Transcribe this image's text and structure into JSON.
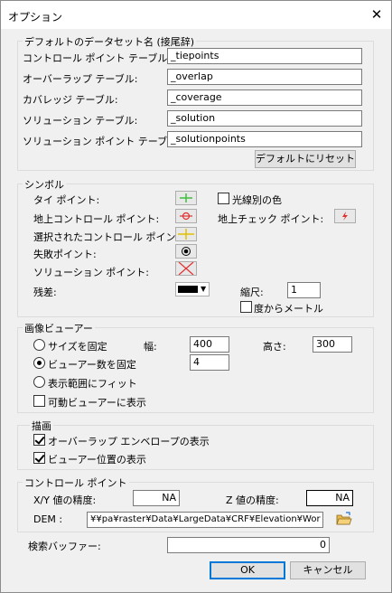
{
  "window": {
    "title": "オプション"
  },
  "dataset_names": {
    "heading": "デフォルトのデータセット名 (接尾辞)",
    "rows": [
      {
        "label": "コントロール ポイント テーブル:",
        "value": "_tiepoints"
      },
      {
        "label": "オーバーラップ テーブル:",
        "value": "_overlap"
      },
      {
        "label": "カバレッジ テーブル:",
        "value": "_coverage"
      },
      {
        "label": "ソリューション テーブル:",
        "value": "_solution"
      },
      {
        "label": "ソリューション ポイント テーブル:",
        "value": "_solutionpoints"
      }
    ],
    "reset_button": "デフォルトにリセット"
  },
  "symbols": {
    "heading": "シンボル",
    "tie_point": "タイ ポイント:",
    "gcp": "地上コントロール ポイント:",
    "selected_gcp": "選択されたコントロール ポイント:",
    "failed_point": "失敗ポイント:",
    "solution_point": "ソリューション ポイント:",
    "residual": "残差:",
    "color_by_ray": "光線別の色",
    "check_point": "地上チェック ポイント:",
    "scale_label": "縮尺:",
    "scale_value": "1",
    "degree_to_meter": "度からメートル",
    "colors": {
      "tie_point": "#3fbf3f",
      "gcp": "#e03030",
      "selected_gcp": "#e0c000",
      "failed": "#000000",
      "solution": "#e03030",
      "residual": "#000000",
      "check_point": "#e03030"
    }
  },
  "image_viewer": {
    "heading": "画像ビューアー",
    "fixed_size": "サイズを固定",
    "width_label": "幅:",
    "width_value": "400",
    "height_label": "高さ:",
    "height_value": "300",
    "fixed_count": "ビューアー数を固定",
    "count_value": "4",
    "fit_extent": "表示範囲にフィット",
    "show_movable": "可動ビューアーに表示"
  },
  "drawing": {
    "heading": "描画",
    "show_overlap": "オーバーラップ エンベロープの表示",
    "show_viewer_pos": "ビューアー位置の表示"
  },
  "control_points": {
    "heading": "コントロール ポイント",
    "xy_label": "X/Y 値の精度:",
    "xy_value": "NA",
    "z_label": "Z 値の精度:",
    "z_value": "NA",
    "dem_label": "DEM :",
    "dem_value": "¥¥pa¥raster¥Data¥LargeData¥CRF¥Elevation¥Wor"
  },
  "search_buffer": {
    "label": "検索バッファー:",
    "value": "0"
  },
  "buttons": {
    "ok": "OK",
    "cancel": "キャンセル"
  }
}
